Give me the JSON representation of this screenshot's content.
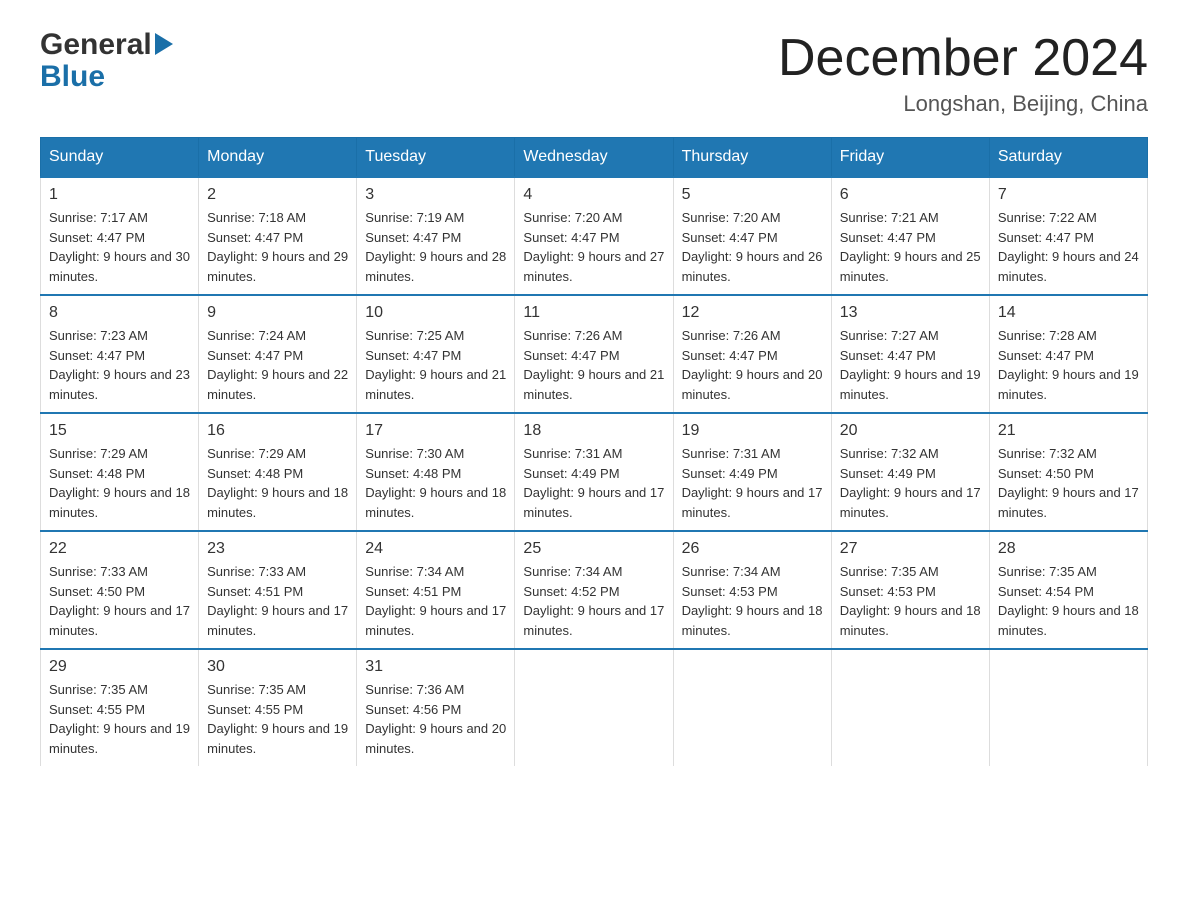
{
  "header": {
    "logo_general": "General",
    "logo_blue": "Blue",
    "month_title": "December 2024",
    "location": "Longshan, Beijing, China"
  },
  "weekdays": [
    "Sunday",
    "Monday",
    "Tuesday",
    "Wednesday",
    "Thursday",
    "Friday",
    "Saturday"
  ],
  "weeks": [
    [
      {
        "day": "1",
        "sunrise": "7:17 AM",
        "sunset": "4:47 PM",
        "daylight": "9 hours and 30 minutes."
      },
      {
        "day": "2",
        "sunrise": "7:18 AM",
        "sunset": "4:47 PM",
        "daylight": "9 hours and 29 minutes."
      },
      {
        "day": "3",
        "sunrise": "7:19 AM",
        "sunset": "4:47 PM",
        "daylight": "9 hours and 28 minutes."
      },
      {
        "day": "4",
        "sunrise": "7:20 AM",
        "sunset": "4:47 PM",
        "daylight": "9 hours and 27 minutes."
      },
      {
        "day": "5",
        "sunrise": "7:20 AM",
        "sunset": "4:47 PM",
        "daylight": "9 hours and 26 minutes."
      },
      {
        "day": "6",
        "sunrise": "7:21 AM",
        "sunset": "4:47 PM",
        "daylight": "9 hours and 25 minutes."
      },
      {
        "day": "7",
        "sunrise": "7:22 AM",
        "sunset": "4:47 PM",
        "daylight": "9 hours and 24 minutes."
      }
    ],
    [
      {
        "day": "8",
        "sunrise": "7:23 AM",
        "sunset": "4:47 PM",
        "daylight": "9 hours and 23 minutes."
      },
      {
        "day": "9",
        "sunrise": "7:24 AM",
        "sunset": "4:47 PM",
        "daylight": "9 hours and 22 minutes."
      },
      {
        "day": "10",
        "sunrise": "7:25 AM",
        "sunset": "4:47 PM",
        "daylight": "9 hours and 21 minutes."
      },
      {
        "day": "11",
        "sunrise": "7:26 AM",
        "sunset": "4:47 PM",
        "daylight": "9 hours and 21 minutes."
      },
      {
        "day": "12",
        "sunrise": "7:26 AM",
        "sunset": "4:47 PM",
        "daylight": "9 hours and 20 minutes."
      },
      {
        "day": "13",
        "sunrise": "7:27 AM",
        "sunset": "4:47 PM",
        "daylight": "9 hours and 19 minutes."
      },
      {
        "day": "14",
        "sunrise": "7:28 AM",
        "sunset": "4:47 PM",
        "daylight": "9 hours and 19 minutes."
      }
    ],
    [
      {
        "day": "15",
        "sunrise": "7:29 AM",
        "sunset": "4:48 PM",
        "daylight": "9 hours and 18 minutes."
      },
      {
        "day": "16",
        "sunrise": "7:29 AM",
        "sunset": "4:48 PM",
        "daylight": "9 hours and 18 minutes."
      },
      {
        "day": "17",
        "sunrise": "7:30 AM",
        "sunset": "4:48 PM",
        "daylight": "9 hours and 18 minutes."
      },
      {
        "day": "18",
        "sunrise": "7:31 AM",
        "sunset": "4:49 PM",
        "daylight": "9 hours and 17 minutes."
      },
      {
        "day": "19",
        "sunrise": "7:31 AM",
        "sunset": "4:49 PM",
        "daylight": "9 hours and 17 minutes."
      },
      {
        "day": "20",
        "sunrise": "7:32 AM",
        "sunset": "4:49 PM",
        "daylight": "9 hours and 17 minutes."
      },
      {
        "day": "21",
        "sunrise": "7:32 AM",
        "sunset": "4:50 PM",
        "daylight": "9 hours and 17 minutes."
      }
    ],
    [
      {
        "day": "22",
        "sunrise": "7:33 AM",
        "sunset": "4:50 PM",
        "daylight": "9 hours and 17 minutes."
      },
      {
        "day": "23",
        "sunrise": "7:33 AM",
        "sunset": "4:51 PM",
        "daylight": "9 hours and 17 minutes."
      },
      {
        "day": "24",
        "sunrise": "7:34 AM",
        "sunset": "4:51 PM",
        "daylight": "9 hours and 17 minutes."
      },
      {
        "day": "25",
        "sunrise": "7:34 AM",
        "sunset": "4:52 PM",
        "daylight": "9 hours and 17 minutes."
      },
      {
        "day": "26",
        "sunrise": "7:34 AM",
        "sunset": "4:53 PM",
        "daylight": "9 hours and 18 minutes."
      },
      {
        "day": "27",
        "sunrise": "7:35 AM",
        "sunset": "4:53 PM",
        "daylight": "9 hours and 18 minutes."
      },
      {
        "day": "28",
        "sunrise": "7:35 AM",
        "sunset": "4:54 PM",
        "daylight": "9 hours and 18 minutes."
      }
    ],
    [
      {
        "day": "29",
        "sunrise": "7:35 AM",
        "sunset": "4:55 PM",
        "daylight": "9 hours and 19 minutes."
      },
      {
        "day": "30",
        "sunrise": "7:35 AM",
        "sunset": "4:55 PM",
        "daylight": "9 hours and 19 minutes."
      },
      {
        "day": "31",
        "sunrise": "7:36 AM",
        "sunset": "4:56 PM",
        "daylight": "9 hours and 20 minutes."
      },
      null,
      null,
      null,
      null
    ]
  ]
}
